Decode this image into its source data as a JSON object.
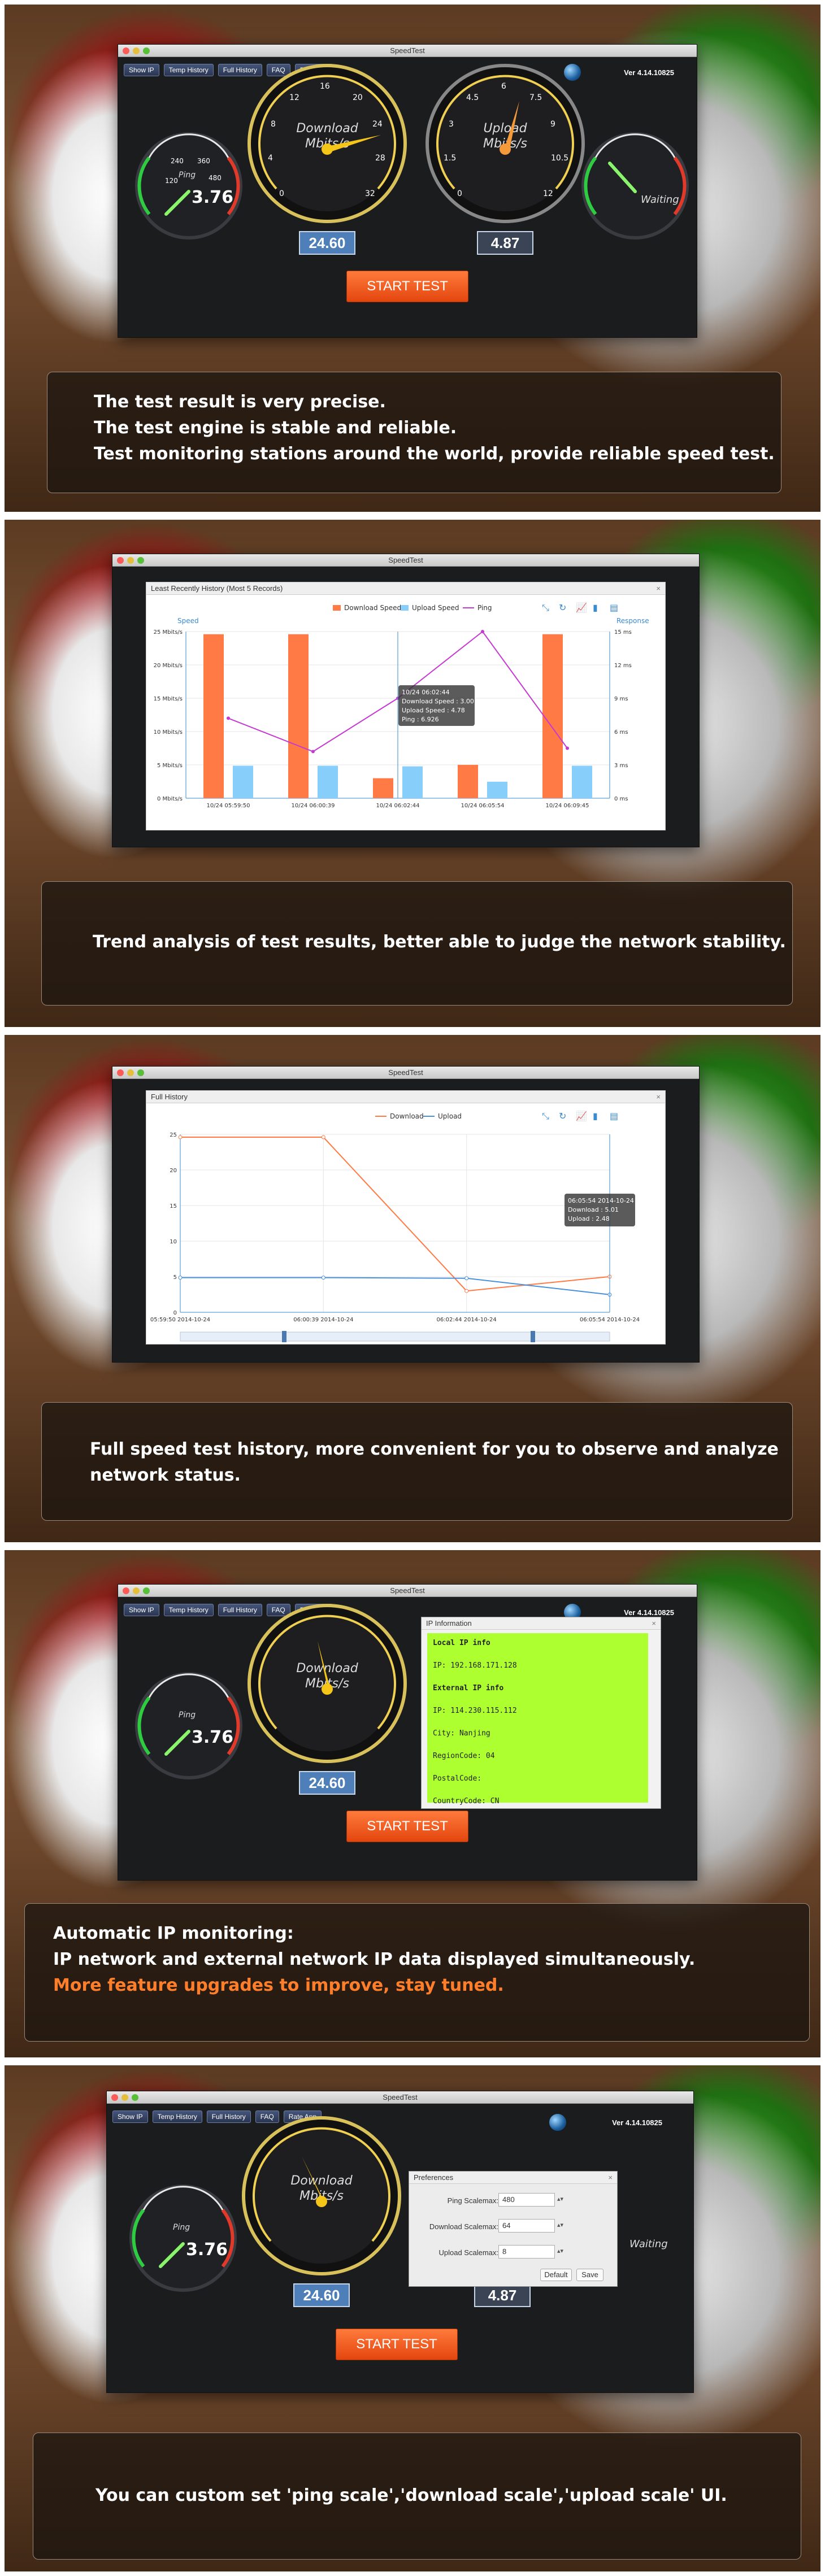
{
  "app": {
    "window_title": "SpeedTest",
    "version": "Ver 4.14.10825",
    "toolbar": [
      "Show IP",
      "Temp History",
      "Full History",
      "FAQ",
      "Rate App"
    ],
    "start_label": "START TEST",
    "ping_label": "Ping",
    "ping_value": "3.76",
    "ping_ticks": [
      "120",
      "240",
      "360",
      "480"
    ],
    "download_label": "Download",
    "upload_label": "Upload",
    "unit": "Mbits/s",
    "download_ticks": [
      "0",
      "4",
      "8",
      "12",
      "16",
      "20",
      "24",
      "28",
      "32"
    ],
    "upload_ticks": [
      "0",
      "1.5",
      "3",
      "4.5",
      "6",
      "7.5",
      "9",
      "10.5",
      "12"
    ],
    "download_value": "24.60",
    "upload_value": "4.87",
    "waiting": "Waiting"
  },
  "captions": {
    "p1": [
      "The test result is very precise.",
      "The test engine is stable and reliable.",
      "Test monitoring stations around the world, provide reliable speed test."
    ],
    "p2": "Trend analysis of test results, better able to judge the network stability.",
    "p3": [
      "Full speed test history, more convenient for you to observe and analyze",
      "network status."
    ],
    "p4": [
      "Automatic IP monitoring:",
      "IP network and external network IP data displayed simultaneously.",
      "More feature upgrades to improve, stay tuned."
    ],
    "p5": "You can custom set 'ping scale','download scale','upload scale' UI."
  },
  "recent": {
    "title": "Least Recently History (Most 5 Records)",
    "legend": [
      "Download Speed",
      "Upload Speed",
      "Ping"
    ],
    "left_axis": "Speed",
    "right_axis": "Response",
    "tooltip": [
      "10/24 06:02:44",
      "Download Speed : 3.00",
      "Upload Speed : 4.78",
      "Ping : 6.926"
    ]
  },
  "full": {
    "title": "Full History",
    "legend": [
      "Download",
      "Upload"
    ],
    "tooltip": [
      "06:05:54 2014-10-24",
      "Download : 5.01",
      "Upload : 2.48"
    ]
  },
  "ip": {
    "title": "IP Information",
    "lines": [
      "Local IP info",
      "IP: 192.168.171.128",
      "External IP info",
      "IP: 114.230.115.112",
      "City: Nanjing",
      "RegionCode: 04",
      "PostalCode:",
      "CountryCode: CN"
    ]
  },
  "prefs": {
    "title": "Preferences",
    "rows": [
      {
        "label": "Ping Scalemax:",
        "value": "480"
      },
      {
        "label": "Download Scalemax:",
        "value": "64"
      },
      {
        "label": "Upload Scalemax:",
        "value": "8"
      }
    ],
    "default": "Default",
    "save": "Save"
  },
  "chart_data": [
    {
      "type": "bar",
      "title": "Least Recently History (Most 5 Records)",
      "categories": [
        "10/24 05:59:50",
        "10/24 06:00:39",
        "10/24 06:02:44",
        "10/24 06:05:54",
        "10/24 06:09:45"
      ],
      "series": [
        {
          "name": "Download Speed",
          "values": [
            24.6,
            24.6,
            3.0,
            5.01,
            24.6
          ],
          "color": "#ff7a45"
        },
        {
          "name": "Upload Speed",
          "values": [
            4.87,
            4.87,
            4.78,
            2.48,
            4.87
          ],
          "color": "#87cefa"
        },
        {
          "name": "Ping",
          "axis": "right",
          "values": [
            7.2,
            4.2,
            9.0,
            15.0,
            4.5
          ],
          "color": "#c43ad0"
        }
      ],
      "ylim": [
        0,
        25
      ],
      "y_ticks": [
        "0 Mbits/s",
        "5 Mbits/s",
        "10 Mbits/s",
        "15 Mbits/s",
        "20 Mbits/s",
        "25 Mbits/s"
      ],
      "y2lim": [
        0,
        15
      ],
      "y2_ticks": [
        "0 ms",
        "3 ms",
        "6 ms",
        "9 ms",
        "12 ms",
        "15 ms"
      ],
      "ylabel": "Speed",
      "y2label": "Response"
    },
    {
      "type": "line",
      "title": "Full History",
      "categories": [
        "05:59:50 2014-10-24",
        "06:00:39 2014-10-24",
        "06:02:44 2014-10-24",
        "06:05:54 2014-10-24"
      ],
      "series": [
        {
          "name": "Download",
          "values": [
            24.6,
            24.6,
            3.0,
            5.01
          ],
          "color": "#ff7a45"
        },
        {
          "name": "Upload",
          "values": [
            4.87,
            4.87,
            4.78,
            2.48
          ],
          "color": "#4a90d9"
        }
      ],
      "ylim": [
        0,
        25
      ],
      "y_ticks": [
        "0",
        "5",
        "10",
        "15",
        "20",
        "25"
      ]
    }
  ]
}
